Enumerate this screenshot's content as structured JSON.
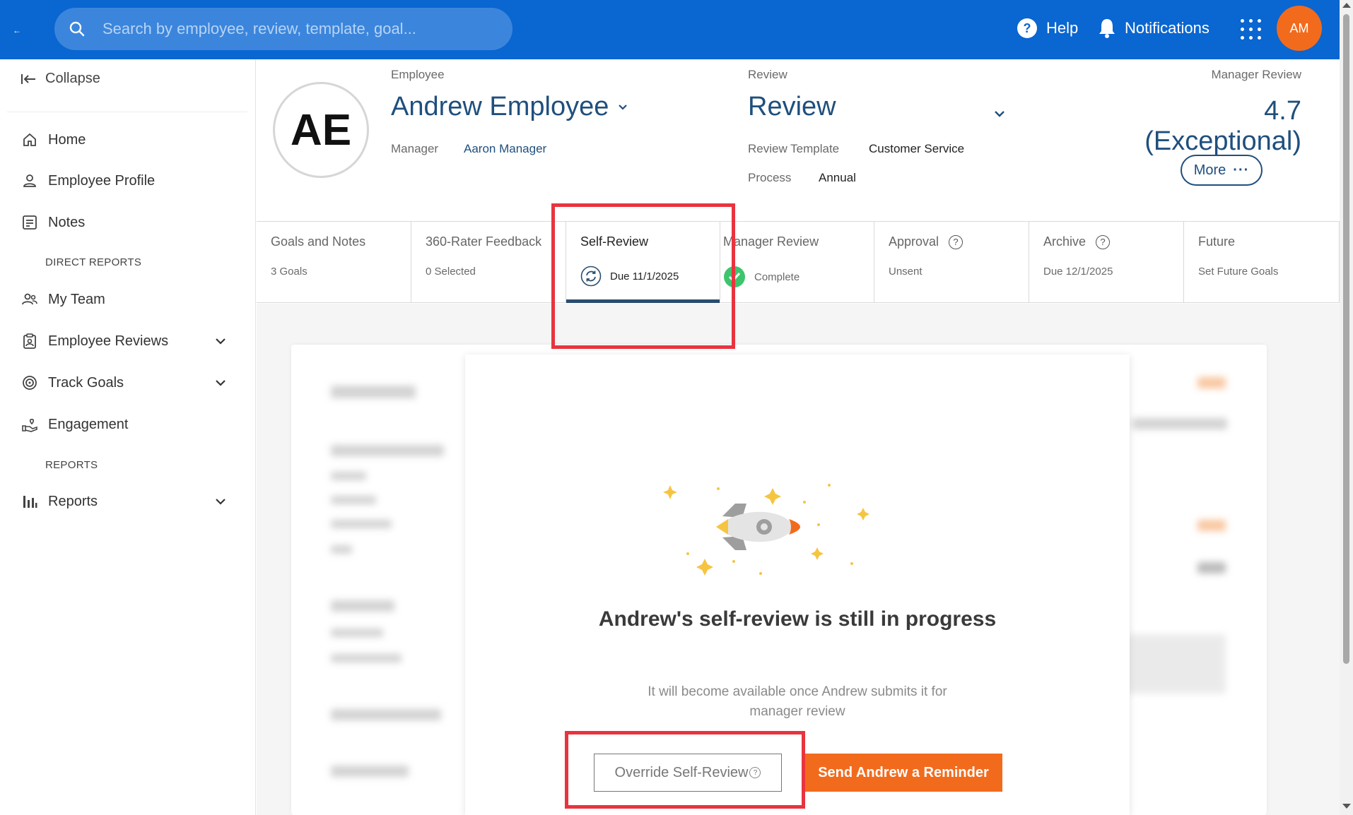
{
  "topbar": {
    "search_placeholder": "Search by employee, review, template, goal...",
    "help_label": "Help",
    "notifications_label": "Notifications",
    "user_initials": "AM",
    "brand_color": "#0a66d0"
  },
  "sidebar": {
    "collapse_label": "Collapse",
    "items": [
      {
        "label": "Home",
        "icon": "home-icon"
      },
      {
        "label": "Employee Profile",
        "icon": "person-icon"
      },
      {
        "label": "Notes",
        "icon": "notes-icon"
      },
      {
        "label": "My Team",
        "icon": "team-icon"
      },
      {
        "label": "Employee Reviews",
        "icon": "clipboard-icon"
      },
      {
        "label": "Track Goals",
        "icon": "target-icon"
      },
      {
        "label": "Engagement",
        "icon": "engagement-icon"
      },
      {
        "label": "Reports",
        "icon": "bar-chart-icon"
      }
    ],
    "sections": {
      "direct_reports": "DIRECT REPORTS",
      "reports": "REPORTS"
    }
  },
  "header": {
    "avatar_initials": "AE",
    "employee_label": "Employee",
    "employee_name": "Andrew Employee",
    "manager_label": "Manager",
    "manager_name": "Aaron Manager",
    "review_label": "Review",
    "review_title": "Review",
    "template_label": "Review Template",
    "template_value": "Customer Service",
    "process_label": "Process",
    "process_value": "Annual",
    "manager_review_label": "Manager Review",
    "score": "4.7 (Exceptional)",
    "more_label": "More"
  },
  "tabs": [
    {
      "title": "Goals and Notes",
      "sub": "3 Goals"
    },
    {
      "title": "360-Rater Feedback",
      "sub": "0 Selected"
    },
    {
      "title": "Self-Review",
      "sub": "Due 11/1/2025",
      "active": true
    },
    {
      "title": "Manager Review",
      "sub": "Complete"
    },
    {
      "title": "Approval",
      "sub": "Unsent"
    },
    {
      "title": "Archive",
      "sub": "Due 12/1/2025"
    },
    {
      "title": "Future",
      "sub": "Set Future Goals"
    }
  ],
  "modal": {
    "title": "Andrew's self-review is still in progress",
    "subtitle": "It will become available once Andrew submits it for manager review",
    "override_label": "Override Self-Review",
    "reminder_label": "Send Andrew a Reminder",
    "accent_color": "#f26b1d"
  }
}
